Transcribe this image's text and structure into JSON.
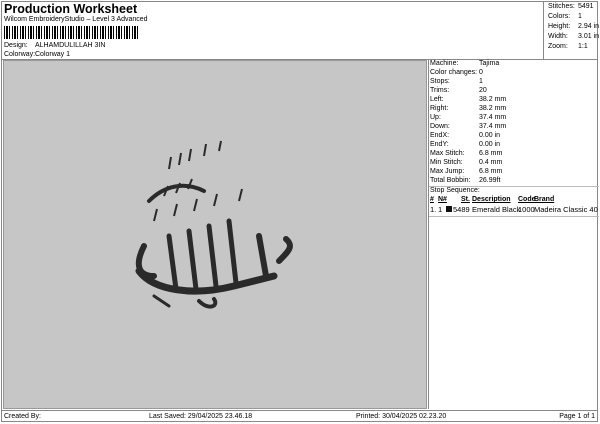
{
  "header": {
    "title": "Production Worksheet",
    "subtitle": "Wilcom EmbroideryStudio – Level 3 Advanced",
    "design_label": "Design:",
    "design_value": "ALHAMDULILLAH 3IN",
    "colorway_label": "Colorway:",
    "colorway_value": "Colorway 1"
  },
  "summary": [
    {
      "label": "Stitches:",
      "value": "5491"
    },
    {
      "label": "Colors:",
      "value": "1"
    },
    {
      "label": "Height:",
      "value": "2.94 in"
    },
    {
      "label": "Width:",
      "value": "3.01 in"
    },
    {
      "label": "Zoom:",
      "value": "1:1"
    }
  ],
  "details": [
    {
      "label": "Machine:",
      "value": "Tajima"
    },
    {
      "label": "Color changes:",
      "value": "0"
    },
    {
      "label": "Stops:",
      "value": "1"
    },
    {
      "label": "Trims:",
      "value": "20"
    },
    {
      "label": "Left:",
      "value": "38.2 mm"
    },
    {
      "label": "Right:",
      "value": "38.2 mm"
    },
    {
      "label": "Up:",
      "value": "37.4 mm"
    },
    {
      "label": "Down:",
      "value": "37.4 mm"
    },
    {
      "label": "EndX:",
      "value": "0.00 in"
    },
    {
      "label": "EndY:",
      "value": "0.00 in"
    },
    {
      "label": "Max Stitch:",
      "value": "6.8 mm"
    },
    {
      "label": "Min Stitch:",
      "value": "0.4 mm"
    },
    {
      "label": "Max Jump:",
      "value": "6.8 mm"
    },
    {
      "label": "Total Bobbin:",
      "value": "26.99ft"
    }
  ],
  "stop_sequence": {
    "title": "Stop Sequence:",
    "headers": [
      "#",
      "N#",
      "St.",
      "Description",
      "Code",
      "Brand"
    ],
    "rows": [
      {
        "num": "1.",
        "n": "1",
        "color": "#111111",
        "st": "5489",
        "description": "Emerald Black",
        "code": "1000",
        "brand": "Madeira Classic 40"
      }
    ]
  },
  "footer": {
    "created_by": "Created By:",
    "last_saved": "Last Saved: 29/04/2025 23.46.18",
    "printed": "Printed: 30/04/2025 02.23.20",
    "page": "Page 1 of 1"
  }
}
